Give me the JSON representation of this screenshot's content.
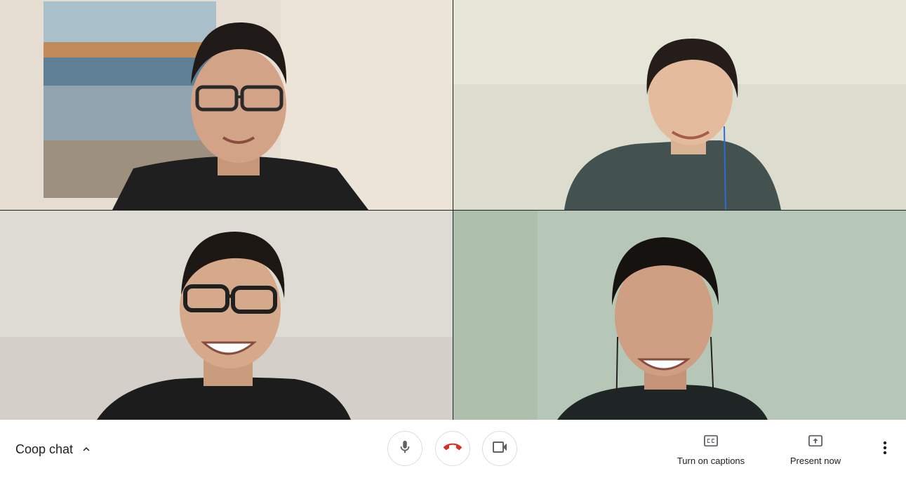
{
  "meeting": {
    "title": "Coop chat",
    "details_icon": "chevron-up-icon"
  },
  "participants": [
    {
      "tile": 1,
      "background": "#e6ddd2"
    },
    {
      "tile": 2,
      "background": "#ddddcf"
    },
    {
      "tile": 3,
      "background": "#dedbd5"
    },
    {
      "tile": 4,
      "background": "#b7c7b7"
    }
  ],
  "controls": {
    "mic_icon": "microphone-icon",
    "hangup_icon": "phone-hangup-icon",
    "camera_icon": "videocam-icon",
    "captions_label": "Turn on captions",
    "captions_icon": "closed-captions-icon",
    "present_label": "Present now",
    "present_icon": "present-screen-icon",
    "more_icon": "more-vert-icon"
  },
  "colors": {
    "hangup": "#d93025",
    "icon": "#5f6368",
    "text": "#202124"
  }
}
